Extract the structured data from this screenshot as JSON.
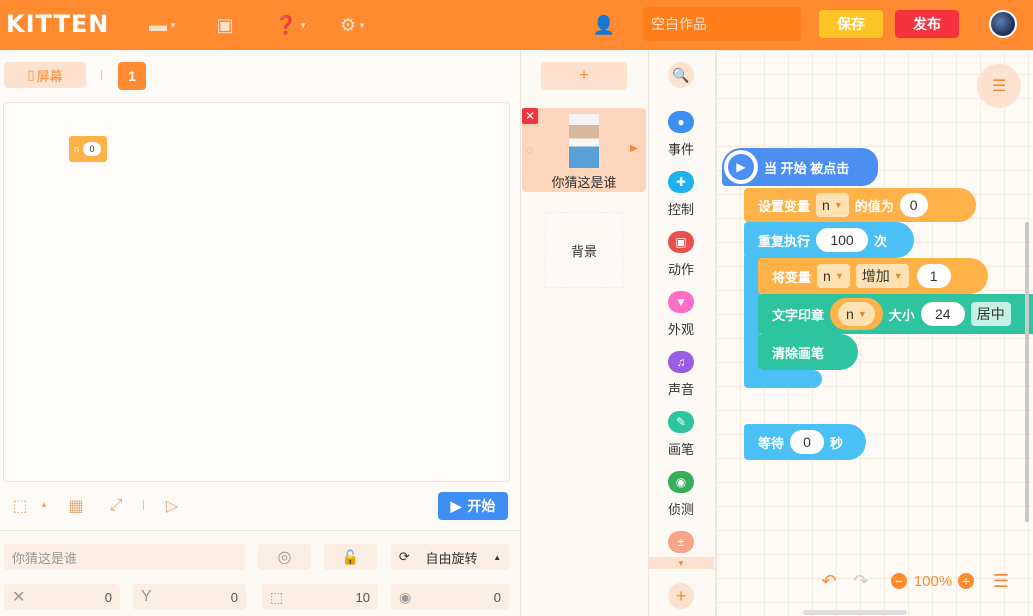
{
  "app": {
    "logo": "KITTEN"
  },
  "toolbar": {
    "title_placeholder": "空白作品",
    "save_label": "保存",
    "publish_label": "发布"
  },
  "stage": {
    "screen_label": "屏幕",
    "screen_number": "1",
    "variable_monitor": {
      "name": "n",
      "value": "0"
    },
    "start_label": "开始"
  },
  "properties": {
    "sprite_name": "你猜这是谁",
    "rotation_label": "自由旋转",
    "x": "0",
    "y": "0",
    "size": "10",
    "direction": "0"
  },
  "sprites": {
    "items": [
      {
        "name": "你猜这是谁"
      }
    ],
    "background_label": "背景",
    "add_label": "+"
  },
  "categories": [
    {
      "label": "事件",
      "color": "#3d8ef5"
    },
    {
      "label": "控制",
      "color": "#1eb1f0"
    },
    {
      "label": "动作",
      "color": "#e8514f"
    },
    {
      "label": "外观",
      "color": "#ff6ec7"
    },
    {
      "label": "声音",
      "color": "#9b5de5"
    },
    {
      "label": "画笔",
      "color": "#2ec4a0"
    },
    {
      "label": "侦测",
      "color": "#35b05a"
    },
    {
      "label": "",
      "color": "#f7a48a"
    }
  ],
  "blocks": {
    "hat": "当 开始 被点击",
    "set_var": {
      "text": "设置变量",
      "var": "n",
      "text2": "的值为",
      "value": "0"
    },
    "repeat": {
      "text": "重复执行",
      "count": "100",
      "text2": "次"
    },
    "change_var": {
      "text": "将变量",
      "var": "n",
      "op": "增加",
      "value": "1"
    },
    "stamp": {
      "text": "文字印章",
      "var": "n",
      "text2": "大小",
      "size": "24",
      "text3": "居中"
    },
    "clear": "清除画笔",
    "wait": {
      "text": "等待",
      "value": "0",
      "text2": "秒"
    }
  },
  "workspace": {
    "zoom": "100%"
  }
}
